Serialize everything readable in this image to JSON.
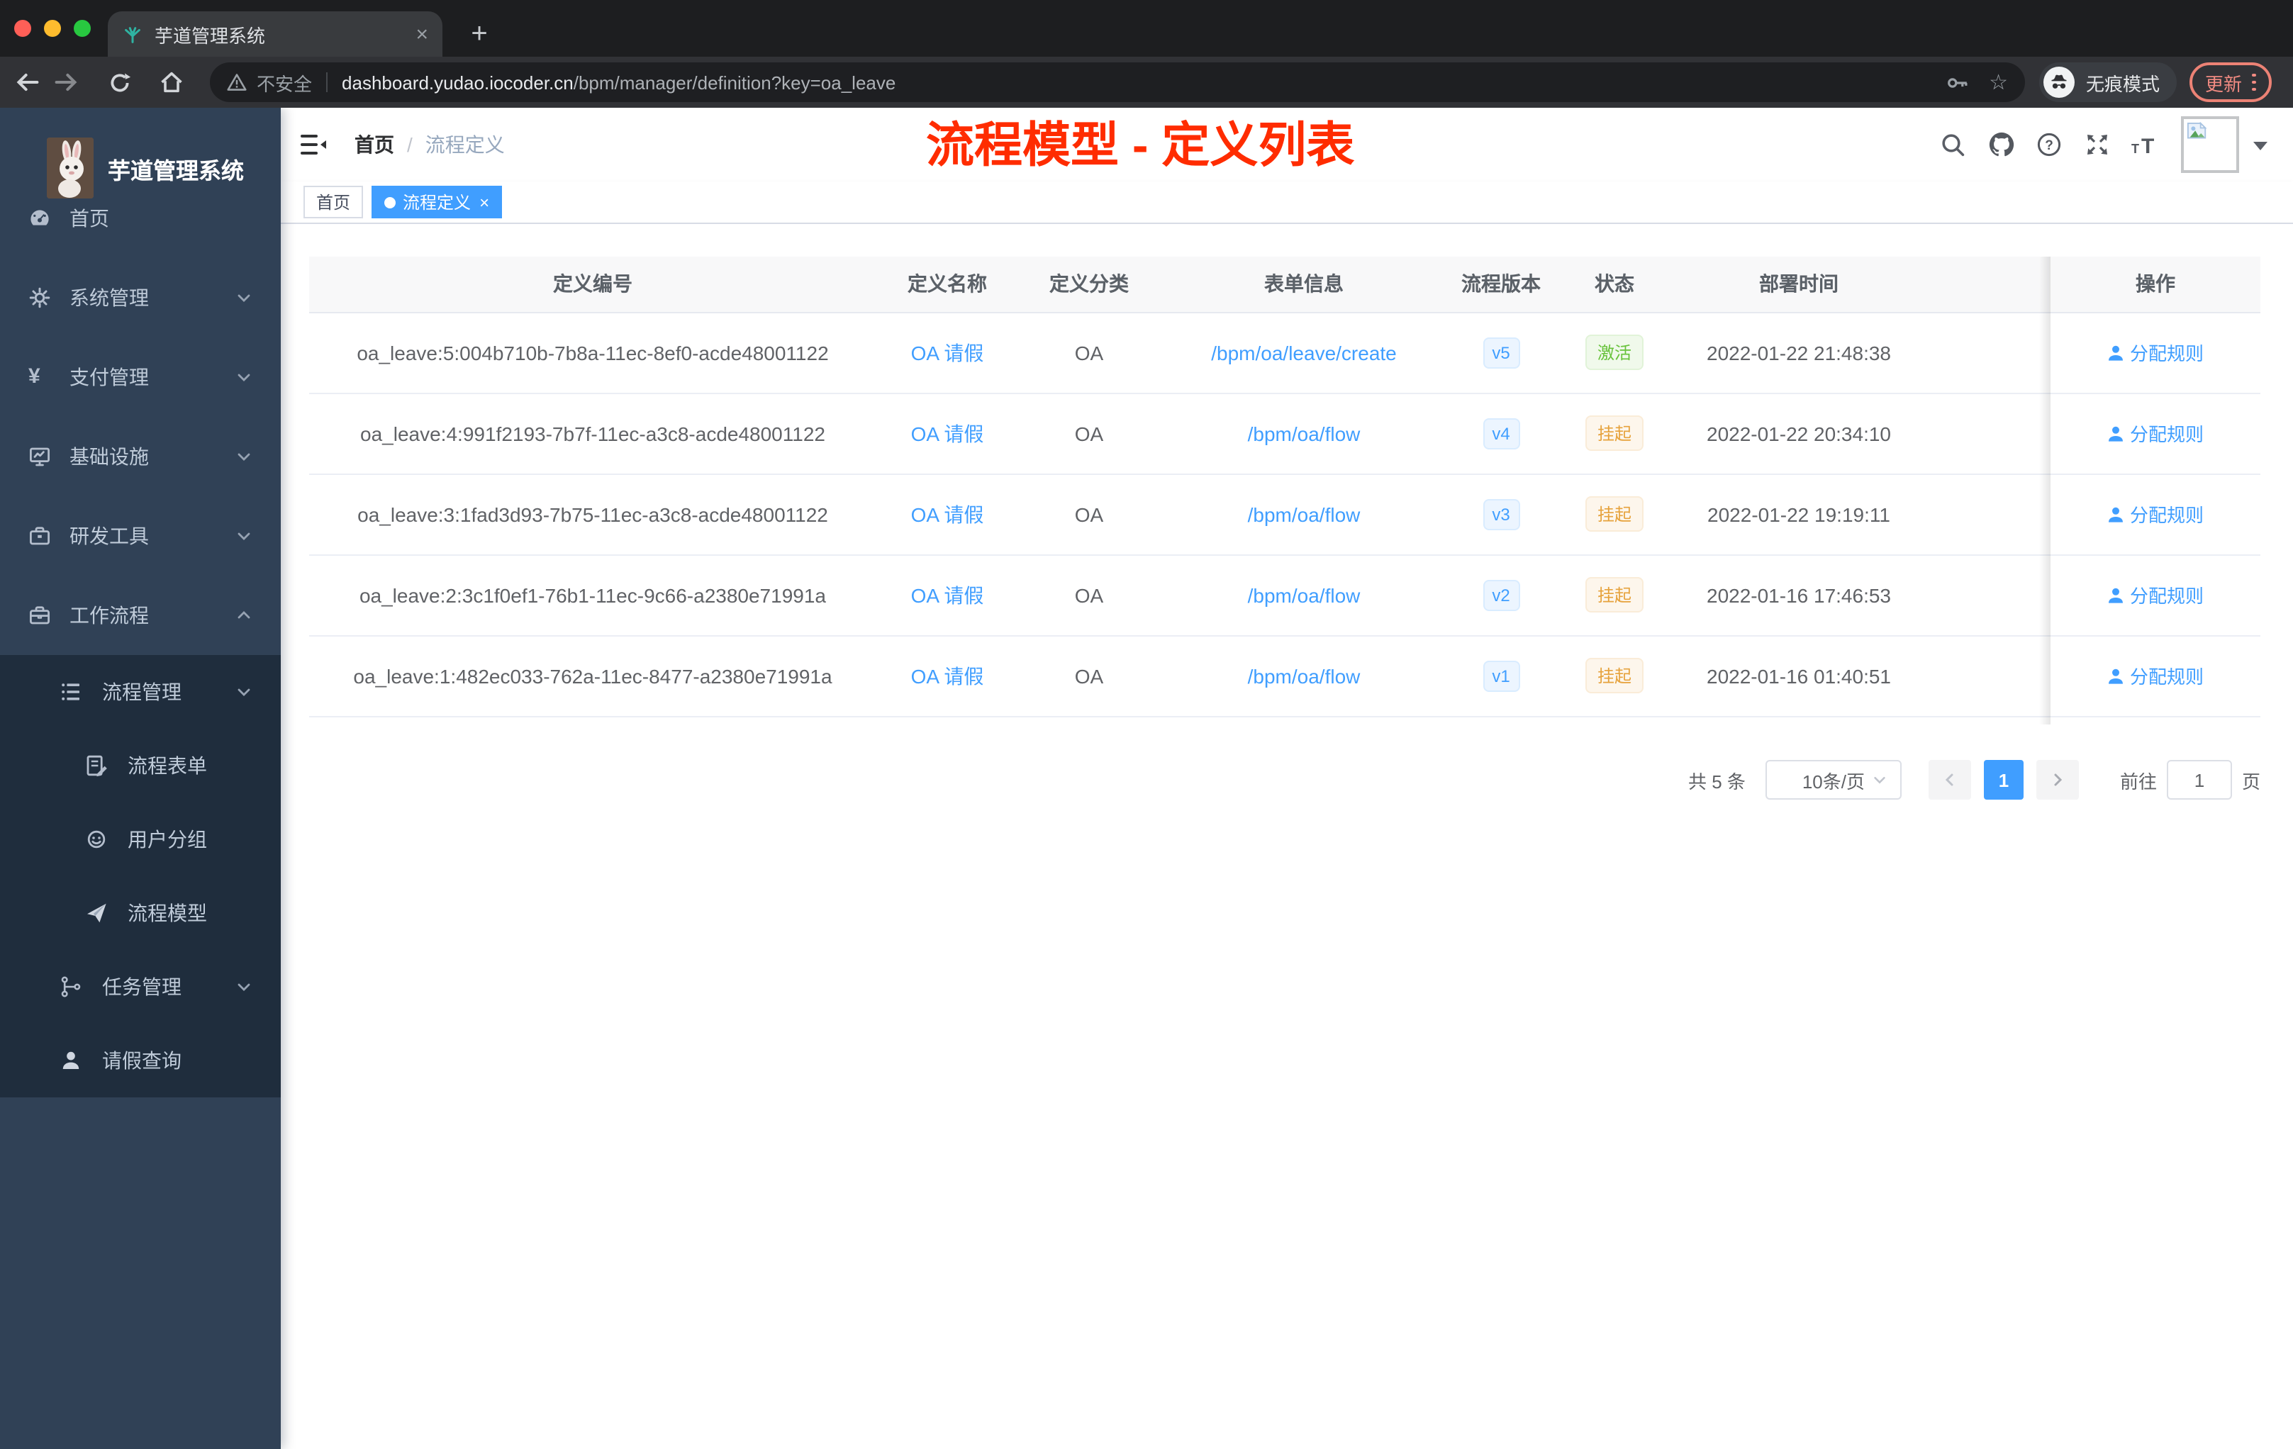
{
  "browser": {
    "tab_title": "芋道管理系统",
    "new_tab_label": "+",
    "tab_close_label": "×",
    "security_label": "不安全",
    "url_domain": "dashboard.yudao.iocoder.cn",
    "url_path": "/bpm/manager/definition?key=oa_leave",
    "incognito_label": "无痕模式",
    "update_label": "更新"
  },
  "sidebar": {
    "logo_title": "芋道管理系统",
    "items": [
      {
        "label": "首页",
        "icon": "dashboard-icon",
        "expandable": false
      },
      {
        "label": "系统管理",
        "icon": "gear-icon",
        "expandable": true,
        "state": "collapsed"
      },
      {
        "label": "支付管理",
        "icon": "yen-icon",
        "expandable": true,
        "state": "collapsed"
      },
      {
        "label": "基础设施",
        "icon": "monitor-icon",
        "expandable": true,
        "state": "collapsed"
      },
      {
        "label": "研发工具",
        "icon": "toolbox-icon",
        "expandable": true,
        "state": "collapsed"
      },
      {
        "label": "工作流程",
        "icon": "briefcase-icon",
        "expandable": true,
        "state": "expanded"
      }
    ],
    "submenu": [
      {
        "label": "流程管理",
        "icon": "list-icon",
        "level": 2,
        "state": "expanded"
      },
      {
        "label": "流程表单",
        "icon": "form-icon",
        "level": 3
      },
      {
        "label": "用户分组",
        "icon": "usergroup-icon",
        "level": 3
      },
      {
        "label": "流程模型",
        "icon": "paper-plane-icon",
        "level": 3
      },
      {
        "label": "任务管理",
        "icon": "tree-icon",
        "level": 2,
        "state": "collapsed"
      },
      {
        "label": "请假查询",
        "icon": "user-icon",
        "level": 2
      }
    ]
  },
  "navbar": {
    "breadcrumb": {
      "home": "首页",
      "separator": "/",
      "current": "流程定义"
    },
    "annotation_title": "流程模型 - 定义列表",
    "icons": [
      "search-icon",
      "github-icon",
      "question-icon",
      "fullscreen-icon",
      "font-size-icon"
    ],
    "avatar": "broken-image-placeholder"
  },
  "tags_view": {
    "tags": [
      {
        "label": "首页",
        "active": false
      },
      {
        "label": "流程定义",
        "active": true,
        "closable": true,
        "close_label": "×"
      }
    ]
  },
  "table": {
    "columns": [
      "定义编号",
      "定义名称",
      "定义分类",
      "表单信息",
      "流程版本",
      "状态",
      "部署时间",
      "操作"
    ],
    "rows": [
      {
        "id": "oa_leave:5:004b710b-7b8a-11ec-8ef0-acde48001122",
        "name": "OA 请假",
        "category": "OA",
        "form": "/bpm/oa/leave/create",
        "version": "v5",
        "status": "激活",
        "status_type": "success",
        "deployed_at": "2022-01-22 21:48:38",
        "action": "分配规则"
      },
      {
        "id": "oa_leave:4:991f2193-7b7f-11ec-a3c8-acde48001122",
        "name": "OA 请假",
        "category": "OA",
        "form": "/bpm/oa/flow",
        "version": "v4",
        "status": "挂起",
        "status_type": "warning",
        "deployed_at": "2022-01-22 20:34:10",
        "action": "分配规则"
      },
      {
        "id": "oa_leave:3:1fad3d93-7b75-11ec-a3c8-acde48001122",
        "name": "OA 请假",
        "category": "OA",
        "form": "/bpm/oa/flow",
        "version": "v3",
        "status": "挂起",
        "status_type": "warning",
        "deployed_at": "2022-01-22 19:19:11",
        "action": "分配规则"
      },
      {
        "id": "oa_leave:2:3c1f0ef1-76b1-11ec-9c66-a2380e71991a",
        "name": "OA 请假",
        "category": "OA",
        "form": "/bpm/oa/flow",
        "version": "v2",
        "status": "挂起",
        "status_type": "warning",
        "deployed_at": "2022-01-16 17:46:53",
        "action": "分配规则"
      },
      {
        "id": "oa_leave:1:482ec033-762a-11ec-8477-a2380e71991a",
        "name": "OA 请假",
        "category": "OA",
        "form": "/bpm/oa/flow",
        "version": "v1",
        "status": "挂起",
        "status_type": "warning",
        "deployed_at": "2022-01-16 01:40:51",
        "action": "分配规则"
      }
    ]
  },
  "pagination": {
    "total": "共 5 条",
    "page_size": "10条/页",
    "current_page": "1",
    "goto_label": "前往",
    "goto_value": "1",
    "unit_label": "页"
  },
  "colors": {
    "accent_blue": "#409eff",
    "success_green": "#67c23a",
    "warning_orange": "#e6a23c",
    "annotation_red": "#ff2c00",
    "sidebar_bg": "#304156",
    "submenu_bg": "#1f2d3d",
    "active_tag_blue": "#409eff"
  }
}
